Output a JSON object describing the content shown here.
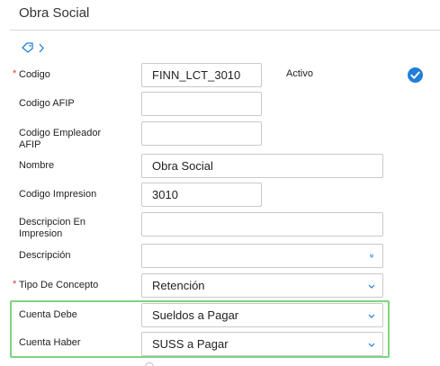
{
  "form": {
    "title": "Obra Social",
    "fields": {
      "codigo": {
        "label": "Codigo",
        "required": true,
        "value": "FINN_LCT_3010"
      },
      "codigo_afip": {
        "label": "Codigo AFIP",
        "value": ""
      },
      "codigo_empleador_afip": {
        "label_line1": "Codigo Empleador",
        "label_line2": "AFIP",
        "value": ""
      },
      "nombre": {
        "label": "Nombre",
        "value": "Obra Social"
      },
      "codigo_impresion": {
        "label": "Codigo Impresion",
        "value": "3010"
      },
      "descripcion_en_impresion": {
        "label_line1": "Descripcion En",
        "label_line2": "Impresion",
        "value": ""
      },
      "descripcion": {
        "label": "Descripción",
        "value": ""
      },
      "tipo_de_concepto": {
        "label": "Tipo De Concepto",
        "required": true,
        "value": "Retención"
      },
      "cuenta_debe": {
        "label": "Cuenta Debe",
        "value": "Sueldos a Pagar"
      },
      "cuenta_haber": {
        "label": "Cuenta Haber",
        "value": "SUSS a Pagar"
      }
    },
    "activo": {
      "label": "Activo",
      "checked": true
    },
    "required_mark": "*"
  },
  "colors": {
    "accent_blue": "#1f7fd8",
    "required_red": "#d23b3b",
    "highlight_green": "#7ed381"
  }
}
